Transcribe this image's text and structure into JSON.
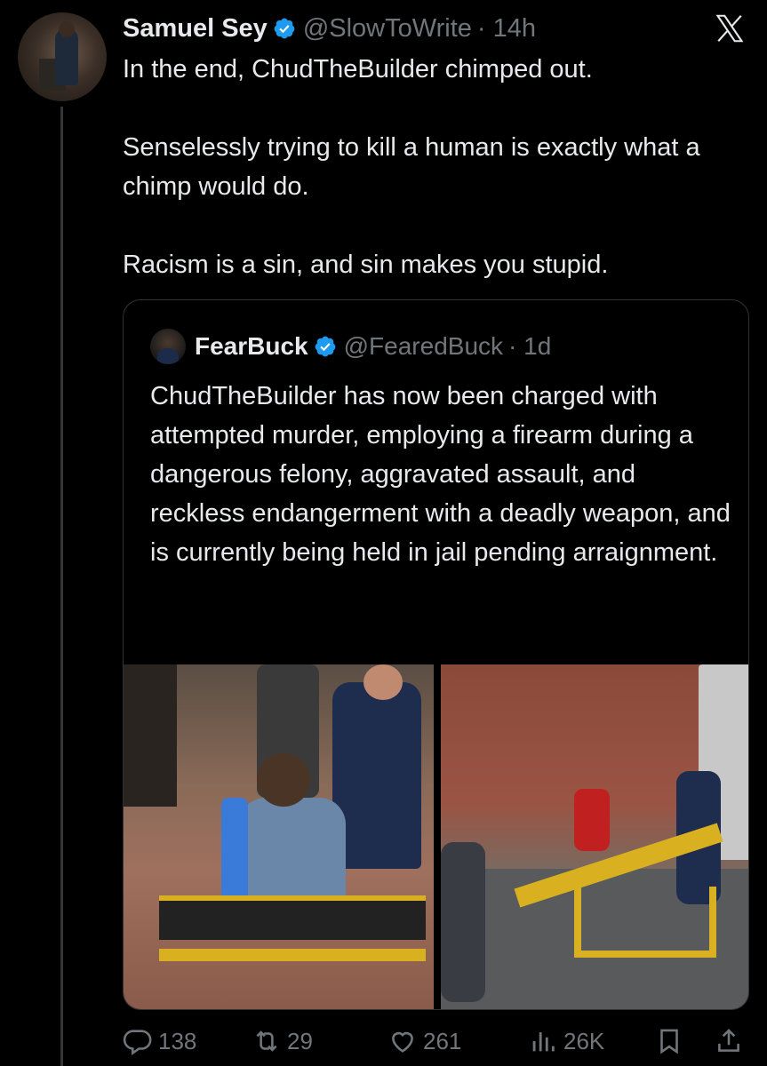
{
  "tweet": {
    "author_name": "Samuel Sey",
    "author_handle": "@SlowToWrite",
    "time": "· 14h",
    "text": "In the end, ChudTheBuilder chimped out.\n\nSenselessly trying to kill a human is exactly what a chimp would do.\n\nRacism is a sin, and sin makes you stupid."
  },
  "quote": {
    "author_name": "FearBuck",
    "author_handle": "@FearedBuck",
    "time": "· 1d",
    "text": "ChudTheBuilder has now been charged with attempted murder, employing a firearm during a dangerous felony, aggravated assault, and reckless endangerment with a deadly weapon, and is currently being held in jail pending arraignment."
  },
  "actions": {
    "replies": "138",
    "retweets": "29",
    "likes": "261",
    "views": "26K"
  },
  "icons": {
    "verified": "verified-badge-icon",
    "logo": "x-logo-icon",
    "reply": "reply-icon",
    "retweet": "retweet-icon",
    "like": "heart-icon",
    "views": "views-icon",
    "bookmark": "bookmark-icon",
    "share": "share-icon"
  },
  "colors": {
    "background": "#000000",
    "text": "#e7e9ea",
    "secondary": "#71767b",
    "verified": "#1d9bf0",
    "border": "#2f3336"
  }
}
